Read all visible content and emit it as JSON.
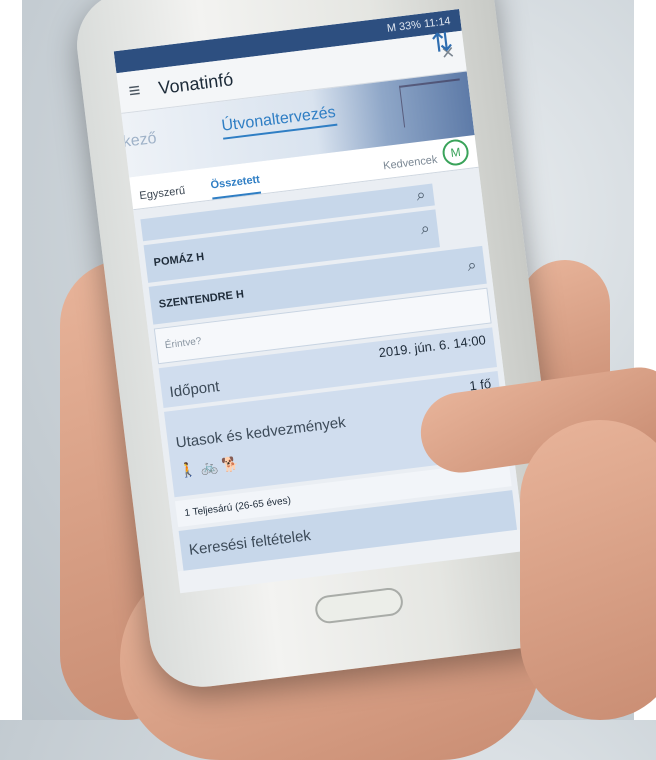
{
  "status": {
    "text": "M 33% 11:14"
  },
  "appbar": {
    "menu_icon": "≡",
    "title": "Vonatinfó",
    "close_icon": "×"
  },
  "banner": {
    "prev_tab": "kező",
    "active_tab": "Útvonaltervezés"
  },
  "subtabs": {
    "simple": "Egyszerű",
    "compound": "Összetett",
    "favorites": "Kedvencek",
    "fav_icon": "M"
  },
  "route": {
    "from": "POMÁZ H",
    "to": "SZENTENDRE H",
    "via_placeholder": "Érintve?",
    "search_icon": "⌕",
    "swap_icon": "⇅"
  },
  "time": {
    "label": "Időpont",
    "value": "2019. jún. 6. 14:00"
  },
  "passengers": {
    "label": "Utasok és kedvezmények",
    "count": "1 fő",
    "icons": "🚶 🚲 🐕",
    "detail": "1 Teljesárú (26-65 éves)"
  },
  "criteria": {
    "label": "Keresési feltételek"
  }
}
